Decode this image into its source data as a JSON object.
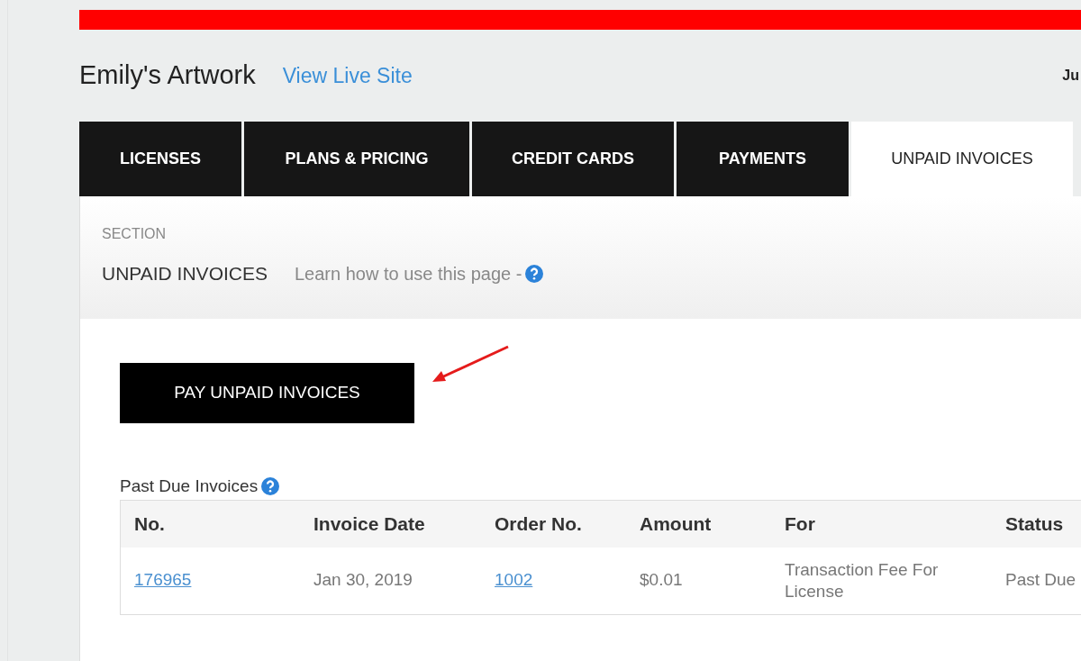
{
  "header": {
    "site_title": "Emily's Artwork",
    "live_site_link": "View Live Site",
    "user_name": "Ju"
  },
  "tabs": [
    {
      "label": "LICENSES",
      "selected": false
    },
    {
      "label": "PLANS & PRICING",
      "selected": false
    },
    {
      "label": "CREDIT CARDS",
      "selected": false
    },
    {
      "label": "PAYMENTS",
      "selected": false
    },
    {
      "label": "UNPAID INVOICES",
      "selected": true
    }
  ],
  "section": {
    "label": "SECTION",
    "title": "UNPAID INVOICES",
    "help_link": "Learn how to use this page -"
  },
  "pay_button": "PAY UNPAID INVOICES",
  "table": {
    "title": "Past Due Invoices",
    "columns": [
      "No.",
      "Invoice Date",
      "Order No.",
      "Amount",
      "For",
      "Status"
    ],
    "rows": [
      [
        {
          "text": "176965",
          "kind": "link"
        },
        {
          "text": "Jan 30, 2019",
          "kind": "text"
        },
        {
          "text": "1002",
          "kind": "link"
        },
        {
          "text": "$0.01",
          "kind": "text"
        },
        {
          "text": "Transaction Fee For License",
          "kind": "text"
        },
        {
          "text": "Past Due",
          "kind": "text"
        }
      ]
    ]
  }
}
